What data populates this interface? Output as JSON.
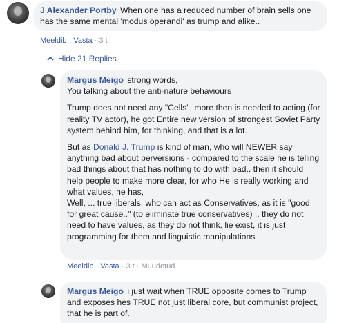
{
  "comment1": {
    "author": "J Alexander Portby",
    "text": "When one has a reduced number of brain sells one has the same mental 'modus operandi' as trump and alike..",
    "actions": {
      "like": "Meeldib",
      "reply": "Vasta",
      "time": "3 t"
    }
  },
  "hide_replies": {
    "icon": "chevron-up-icon",
    "label": "Hide 21 Replies"
  },
  "reply1": {
    "author": "Margus Meigo",
    "line1": "strong words,",
    "line2": "You talking about the anti-nature behaviours",
    "para2": "Trump does not need any \"Cells\", more then is needed to acting (for reality TV actor), he got Entire new version of strongest Soviet Party system behind him, for thinking, and that is a lot.",
    "para3_before": "But as",
    "para3_link": "Donald J. Trump",
    "para3_after": "is kind of man, who will NEWER say anything bad about perversions - compared to the scale he is telling bad things about that has nothing to do with bad.. then it should help people to make more clear, for who He is really working and what values, he has,",
    "para3_line2": "Well, ... true liberals, who can act as Conservatives, as it is \"good for great cause..\" (to eliminate true conservatives) .. they do not need to have values, as they do not think, lie exist, it is just programming for them and linguistic manipulations",
    "actions": {
      "like": "Meeldib",
      "reply": "Vasta",
      "time": "3 t",
      "edited": "Muudetud"
    }
  },
  "reply2": {
    "author": "Margus Meigo",
    "text": "i just wait when TRUE opposite comes to Trump and exposes hes TRUE not just liberal core, but communist project, that he is part of."
  },
  "colors": {
    "link": "#385898",
    "bubble": "#f2f3f5",
    "meta": "#90949c"
  }
}
